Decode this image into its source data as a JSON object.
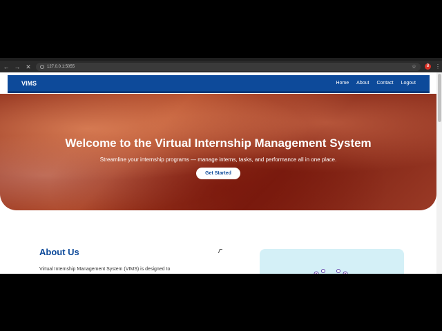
{
  "browser": {
    "url": "127.0.0.1:5055",
    "profile_initial": "B",
    "icons": [
      "back-arrow-icon",
      "forward-arrow-icon",
      "close-icon",
      "site-info-icon",
      "star-icon",
      "menu-dots-icon"
    ]
  },
  "navbar": {
    "brand": "VIMS",
    "links": [
      "Home",
      "About",
      "Contact",
      "Logout"
    ]
  },
  "hero": {
    "title": "Welcome to the Virtual Internship Management System",
    "subtitle": "Streamline your internship programs — manage interns, tasks, and performance all in one place.",
    "cta_label": "Get Started"
  },
  "about": {
    "heading": "About Us",
    "body": "Virtual Internship Management System (VIMS) is designed to"
  },
  "colors": {
    "primary": "#0d4a9a",
    "card_bg": "#d4f0f7",
    "illustration": "#5b3fa8"
  }
}
